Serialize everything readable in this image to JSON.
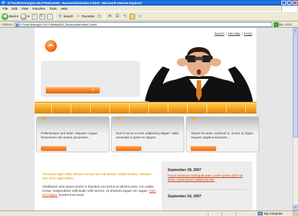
{
  "window": {
    "title": "D:\\Tuvik\\Testing\\01.09.07\\Nebra\\001_Ramuvz\\site\\index-3.html - Microsoft Internet Explorer",
    "minimize": "_",
    "maximize": "□",
    "close": "×"
  },
  "menu": {
    "items": [
      "File",
      "Edit",
      "View",
      "Favorites",
      "Tools",
      "Help"
    ]
  },
  "toolbar": {
    "back": "Back",
    "search": "Search",
    "favorites": "Favorites"
  },
  "address": {
    "label": "Address",
    "value": "D:\\Tuvik\\Testing\\01.09.07\\Nebra\\001_Ramuvz\\site\\index-3.html",
    "go": "Go",
    "links": "Links"
  },
  "page": {
    "toplinks": {
      "search": "Search",
      "sep": "|",
      "sitemap": "Site Map",
      "faqs": "FAQ's"
    },
    "boxes": [
      {
        "text": "Pellentesque sed dolor. Aliquam congue fermentum nisl mauris accumsan..."
      },
      {
        "text": "Sed in lacus ut enim adipiscing aliquet. Nulla venenatis in pede mi aliquet..."
      },
      {
        "text": "Aliquet sit amet, euismod in, auctor ut, ligula. Aliquam dapibus tincidunt..."
      }
    ],
    "content": {
      "headline": "Vivamus eget nibh. Etiam cursus leo vel metus. Nulla facilisi. Aenean nec eros eget tellus.",
      "para_before": "Vestibulum ante ipsum primis in faucibus orci luctus et ultrices posu- ere cubilia Curae; Suspendisse sollicitudin velit sed leo. Ut pharetra augue nec augue.",
      "para_link": "Nam elit magna,",
      "para_after": "hendrerit sit amet:"
    },
    "sidebar": {
      "date1": "September 29, 2007",
      "news1": "Fusce euismod consequat ante. Lorem ipsum dolor sit amet, consectetuer adipiscing elit.",
      "date2": "September 24, 2007"
    }
  },
  "status": {
    "zone": "My Computer"
  },
  "colors": {
    "accent": "#f5a623",
    "link": "#d33a0a",
    "headline": "#e8a21a"
  }
}
